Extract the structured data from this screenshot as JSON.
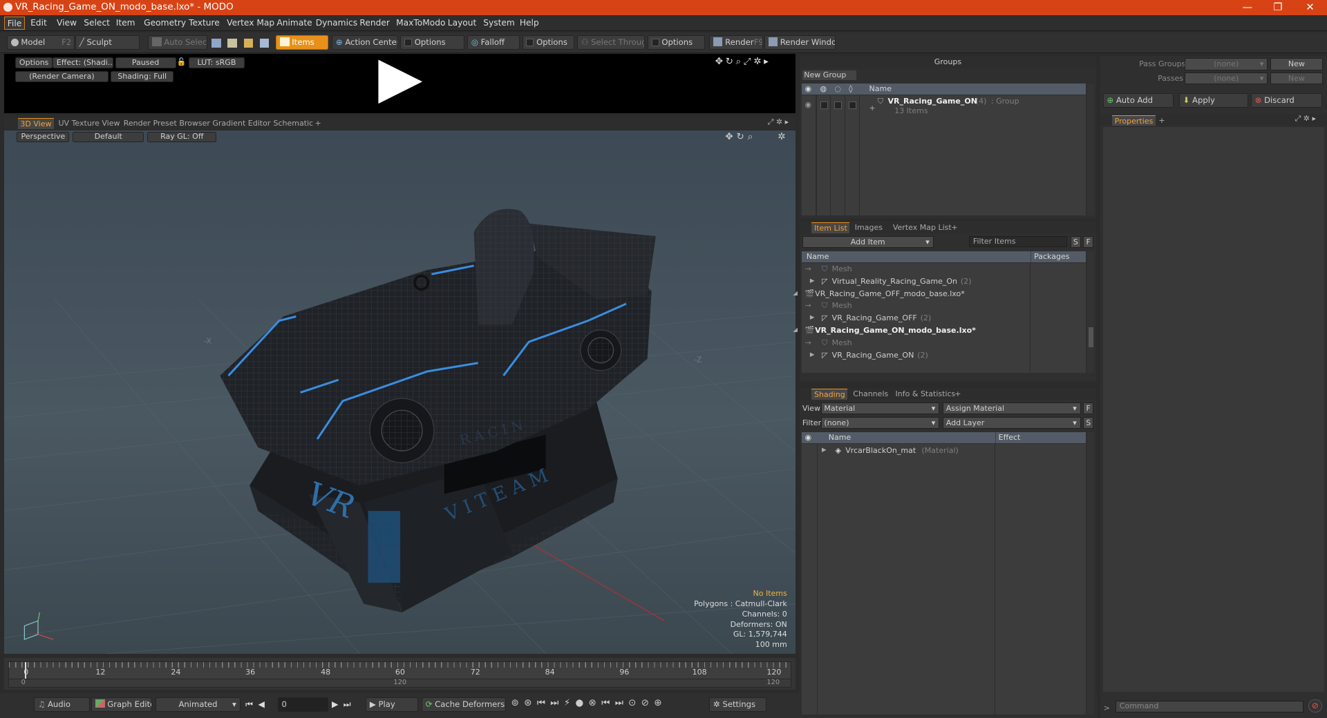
{
  "window": {
    "title": "VR_Racing_Game_ON_modo_base.lxo* - MODO",
    "minimize": "—",
    "restore": "❐",
    "close": "✕"
  },
  "menu": [
    "File",
    "Edit",
    "View",
    "Select",
    "Item",
    "Geometry",
    "Texture",
    "Vertex Map",
    "Animate",
    "Dynamics",
    "Render",
    "MaxToModo",
    "Layout",
    "System",
    "Help"
  ],
  "toolbar": {
    "model": "Model",
    "model_key": "F2",
    "sculpt": "Sculpt",
    "auto_select": "Auto Select",
    "items": "Items",
    "action_center": "Action Center",
    "options": "Options",
    "falloff": "Falloff",
    "select_through": "Select Through",
    "render": "Render",
    "render_key": "F9",
    "render_window": "Render Window"
  },
  "preview": {
    "options": "Options",
    "effect": "Effect: (Shadi...",
    "paused": "Paused",
    "lut": "LUT: sRGB",
    "camera": "(Render Camera)",
    "shading": "Shading: Full"
  },
  "view_tabs": [
    "3D View",
    "UV Texture View",
    "Render Preset Browser",
    "Gradient Editor",
    "Schematic",
    "+"
  ],
  "viewport": {
    "perspective": "Perspective",
    "default": "Default",
    "raygl": "Ray GL: Off",
    "axis_x": "-X",
    "axis_z": "-Z",
    "stats": {
      "no_items": "No Items",
      "polygons": "Polygons : Catmull-Clark",
      "channels": "Channels: 0",
      "deformers": "Deformers: ON",
      "gl": "GL: 1,579,744",
      "scale": "100 mm"
    },
    "model_texts": {
      "vr": "VR",
      "team": "V I T E A M",
      "racing": "R A C I N"
    }
  },
  "timeline": {
    "ticks": [
      "0",
      "12",
      "24",
      "36",
      "48",
      "60",
      "72",
      "84",
      "96",
      "108",
      "120"
    ],
    "low0": "0",
    "low_mid": "120",
    "low_end": "120"
  },
  "transport": {
    "audio": "Audio",
    "graph": "Graph Editor",
    "animated": "Animated",
    "frame": "0",
    "play": "Play",
    "cache": "Cache Deformers",
    "settings": "Settings"
  },
  "groups": {
    "title": "Groups",
    "new_group": "New Group",
    "col_name": "Name",
    "item_name": "VR_Racing_Game_ON",
    "item_count": "(4)",
    "item_type": ": Group",
    "item_sub": "13 Items"
  },
  "itemlist": {
    "tabs": [
      "Item List",
      "Images",
      "Vertex Map List",
      "+"
    ],
    "add_item": "Add Item",
    "filter": "Filter Items",
    "s": "S",
    "f": "F",
    "col_name": "Name",
    "col_packages": "Packages",
    "rows": [
      {
        "text": "Mesh",
        "dim": true,
        "indent": 1
      },
      {
        "text": "Virtual_Reality_Racing_Game_On",
        "count": "(2)",
        "indent": 1,
        "arrow": "▶"
      },
      {
        "text": "VR_Racing_Game_OFF_modo_base.lxo*",
        "indent": 0,
        "arrow": "◢"
      },
      {
        "text": "Mesh",
        "dim": true,
        "indent": 1
      },
      {
        "text": "VR_Racing_Game_OFF",
        "count": "(2)",
        "indent": 1,
        "arrow": "▶"
      },
      {
        "text": "VR_Racing_Game_ON_modo_base.lxo*",
        "indent": 0,
        "arrow": "◢",
        "bold": true
      },
      {
        "text": "Mesh",
        "dim": true,
        "indent": 1
      },
      {
        "text": "VR_Racing_Game_ON",
        "count": "(2)",
        "indent": 1,
        "arrow": "▶"
      }
    ]
  },
  "shading": {
    "tabs": [
      "Shading",
      "Channels",
      "Info & Statistics",
      "+"
    ],
    "view_label": "View",
    "view_value": "Material",
    "assign": "Assign Material",
    "f": "F",
    "filter_label": "Filter",
    "filter_value": "(none)",
    "add_layer": "Add Layer",
    "s": "S",
    "col_name": "Name",
    "col_effect": "Effect",
    "mat": "VrcarBlackOn_mat",
    "mat_type": "(Material)"
  },
  "right": {
    "pass_groups": "Pass Groups",
    "passes": "Passes",
    "none": "(none)",
    "new": "New",
    "auto_add": "Auto Add",
    "apply": "Apply",
    "discard": "Discard",
    "properties": "Properties",
    "plus": "+",
    "command": "Command"
  },
  "colors": {
    "accent": "#e8911a",
    "title": "#d84315",
    "select_blue": "#535b66"
  }
}
